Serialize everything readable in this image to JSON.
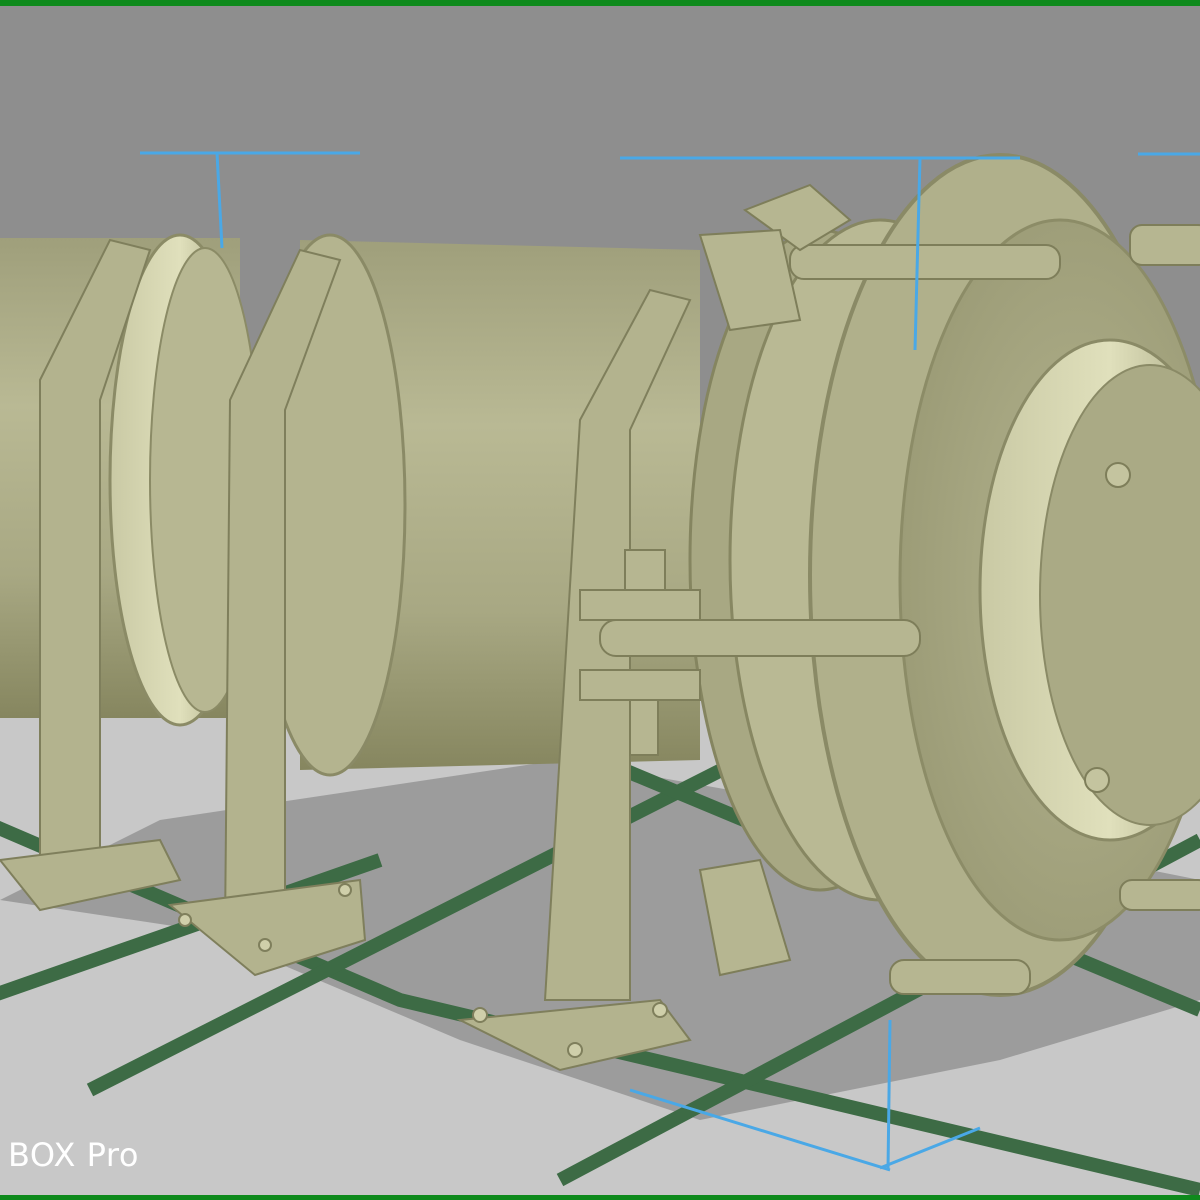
{
  "watermark": {
    "text": "BOX Pro"
  },
  "colors": {
    "frame": "#0e8a1c",
    "sky": "#8c8c8c",
    "floor": "#c9c9c9",
    "grid_line": "#3f6e45",
    "model": "#b3b38d",
    "model_dark": "#83835f",
    "model_light": "#d3d3ae",
    "dimension_line": "#4aa8e6",
    "shadow": "#8a8a8a"
  },
  "scene": {
    "object": "cylindrical-pressure-vessel-on-saddle-supports",
    "view": "3d-perspective"
  }
}
